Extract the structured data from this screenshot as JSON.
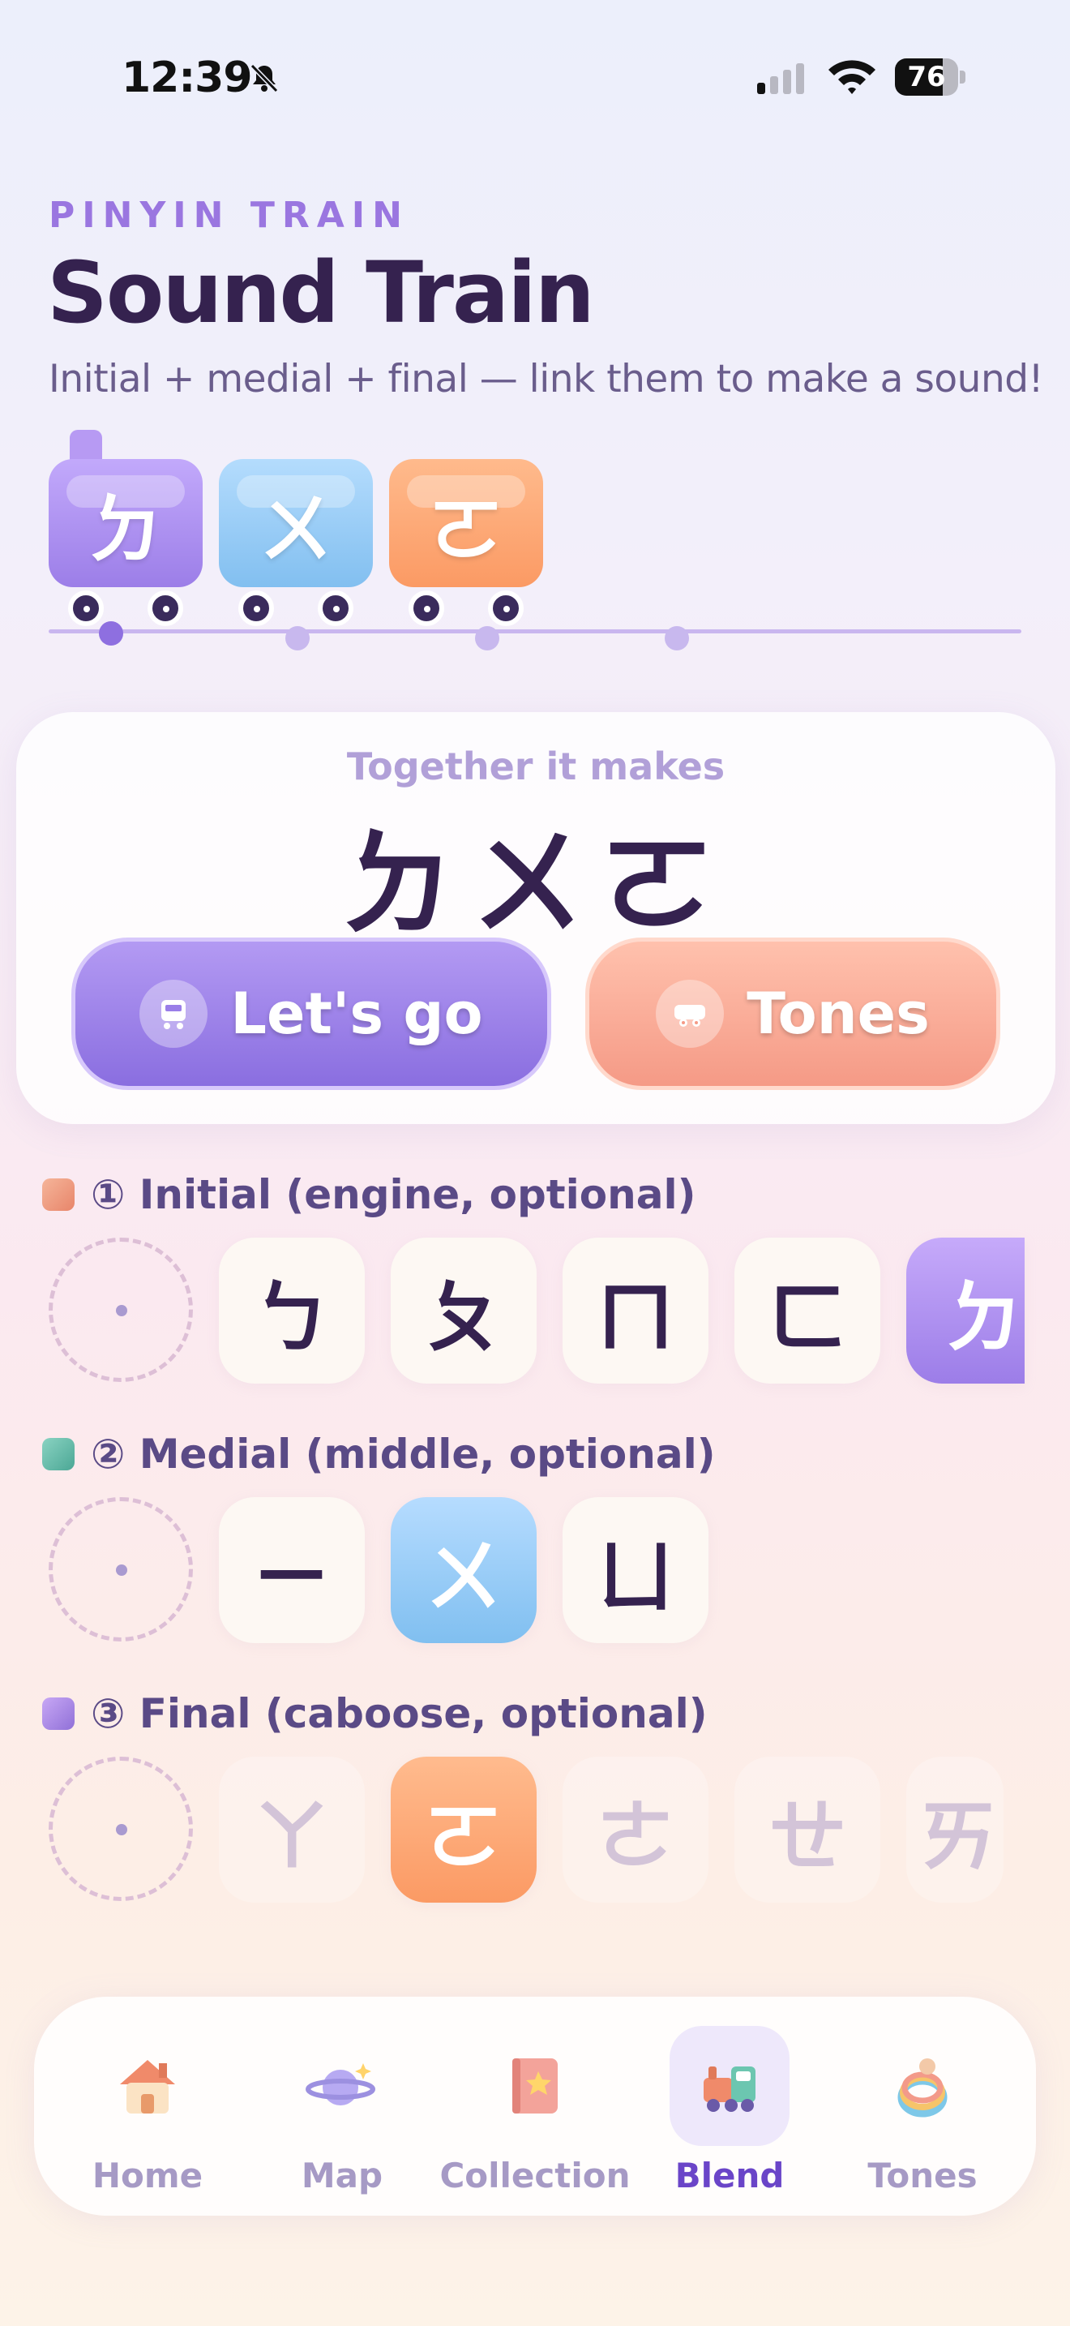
{
  "status_bar": {
    "time": "12:39",
    "battery": "76",
    "battery_level": 0.76
  },
  "header": {
    "eyebrow": "PINYIN TRAIN",
    "title": "Sound Train",
    "subtitle": "Initial + medial + final — link them to make a sound!"
  },
  "train": {
    "cars": [
      {
        "symbol": "ㄉ",
        "color": "#a98af0"
      },
      {
        "symbol": "ㄨ",
        "color": "#8ec9f5"
      },
      {
        "symbol": "ㄛ",
        "color": "#fd9f6c"
      }
    ]
  },
  "result": {
    "label": "Together it makes",
    "combination": "ㄉㄨㄛ",
    "go_button": "Let's go",
    "tones_button": "Tones"
  },
  "sections": {
    "initial": {
      "heading": "① Initial (engine, optional)",
      "options": [
        "ㄅ",
        "ㄆ",
        "ㄇ",
        "ㄈ",
        "ㄉ"
      ],
      "selected": "ㄉ"
    },
    "medial": {
      "heading": "② Medial (middle, optional)",
      "options": [
        "ㄧ",
        "ㄨ",
        "ㄩ"
      ],
      "selected": "ㄨ"
    },
    "final": {
      "heading": "③ Final (caboose, optional)",
      "options": [
        "ㄚ",
        "ㄛ",
        "ㄜ",
        "ㄝ",
        "ㄞ"
      ],
      "selected": "ㄛ"
    }
  },
  "tab_bar": {
    "items": [
      {
        "label": "Home",
        "icon": "house-icon"
      },
      {
        "label": "Map",
        "icon": "planet-icon"
      },
      {
        "label": "Collection",
        "icon": "book-star-icon"
      },
      {
        "label": "Blend",
        "icon": "toy-train-icon",
        "active": true
      },
      {
        "label": "Tones",
        "icon": "ring-toy-icon"
      }
    ]
  },
  "colors": {
    "accent_purple": "#8a6ee0",
    "accent_orange": "#f59a86",
    "title": "#35224f"
  }
}
